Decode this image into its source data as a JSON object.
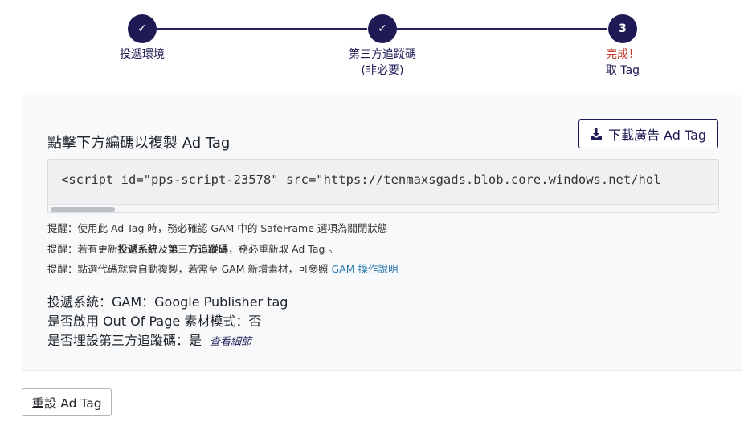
{
  "stepper": {
    "steps": [
      {
        "marker": "✓",
        "label": "投遞環境",
        "sublabel": ""
      },
      {
        "marker": "✓",
        "label": "第三方追蹤碼",
        "sublabel": "(非必要)"
      },
      {
        "marker": "3",
        "label": "完成！",
        "sublabel": "取 Tag"
      }
    ]
  },
  "panel": {
    "title": "點擊下方編碼以複製 Ad Tag",
    "download_label": "下載廣告 Ad Tag",
    "code": "<script id=\"pps-script-23578\" src=\"https://tenmaxsgads.blob.core.windows.net/hol",
    "notes": {
      "n1": "提醒：使用此 Ad Tag 時，務必確認 GAM 中的 SafeFrame 選項為關閉狀態",
      "n2_prefix": "提醒：若有更新",
      "n2_bold1": "投遞系統",
      "n2_mid": "及",
      "n2_bold2": "第三方追蹤碼",
      "n2_suffix": "，務必重新取 Ad Tag 。",
      "n3_prefix": "提醒：點選代碼就會自動複製，若需至 GAM 新增素材，可參照 ",
      "n3_link": "GAM 操作說明"
    },
    "info": {
      "system": "投遞系統：GAM：Google Publisher tag",
      "oop": "是否啟用 Out Of Page 素材模式：否",
      "tracking": "是否埋設第三方追蹤碼：是",
      "details_link": "查看細節"
    }
  },
  "reset_label": "重設 Ad Tag",
  "colors": {
    "primary": "#1e1b54",
    "done": "#c0392b",
    "link": "#2a7ab0"
  }
}
